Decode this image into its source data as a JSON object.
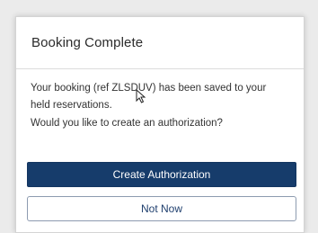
{
  "dialog": {
    "title": "Booking Complete",
    "message_line1": "Your booking (ref ZLSDUV) has been saved to your",
    "message_line2": "held reservations.",
    "question": "Would you like to create an authorization?",
    "primary_button_label": "Create Authorization",
    "secondary_button_label": "Not Now"
  },
  "colors": {
    "primary_button": "#163c6b",
    "secondary_button_text": "#1f3f6e",
    "backdrop": "#ebebeb"
  },
  "icons": {
    "cursor": "mouse-pointer-icon"
  }
}
